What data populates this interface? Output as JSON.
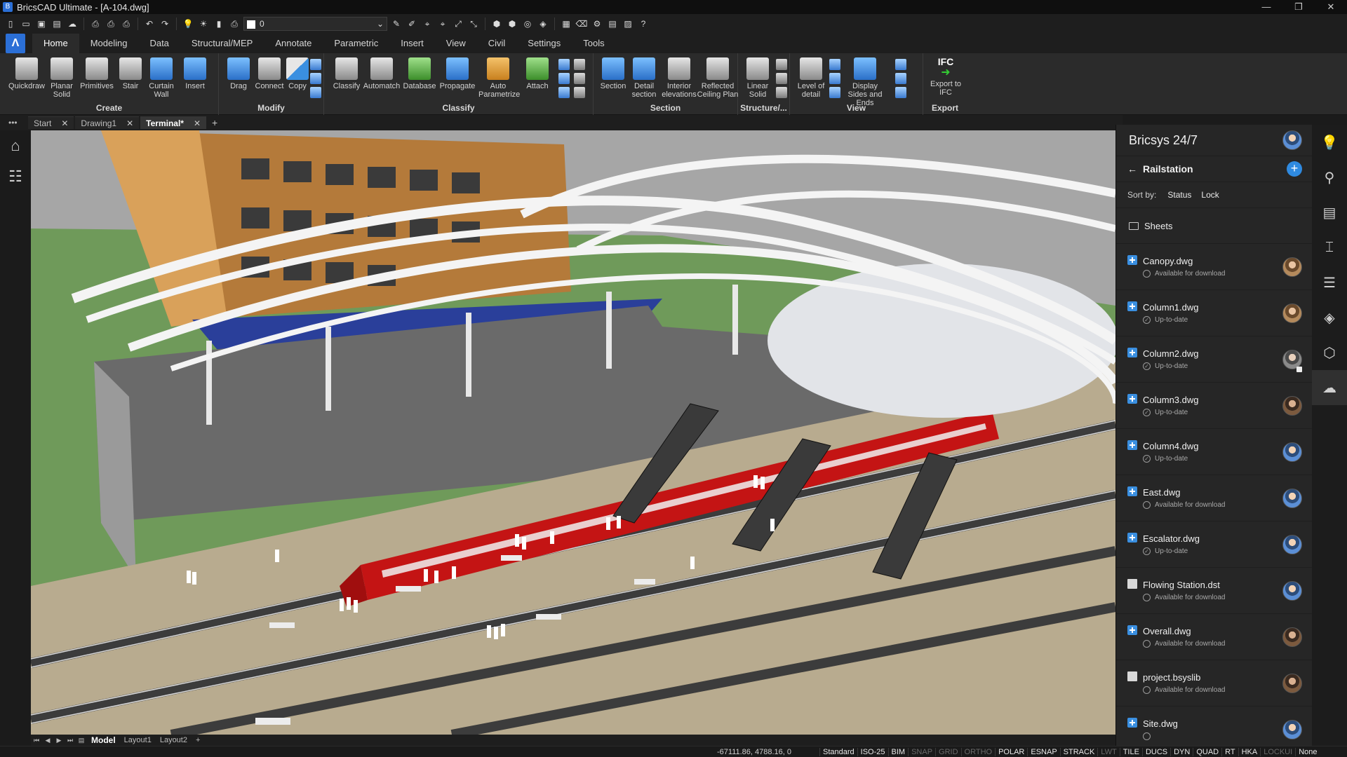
{
  "window": {
    "title": "BricsCAD Ultimate - [A-104.dwg]",
    "controls": [
      "—",
      "❐",
      "✕"
    ]
  },
  "quick_access": {
    "layer_value": "0"
  },
  "ribbon_tabs": [
    "Home",
    "Modeling",
    "Data",
    "Structural/MEP",
    "Annotate",
    "Parametric",
    "Insert",
    "View",
    "Civil",
    "Settings",
    "Tools"
  ],
  "ribbon": {
    "groups": {
      "create": "Create",
      "modify": "Modify",
      "classify": "Classify",
      "section": "Section",
      "structure": "Structure/...",
      "view": "View",
      "export": "Export"
    },
    "buttons": {
      "quickdraw": "Quickdraw",
      "planar_solid": "Planar Solid",
      "primitives": "Primitives",
      "stair": "Stair",
      "curtain_wall": "Curtain Wall",
      "insert": "Insert",
      "drag": "Drag",
      "connect": "Connect",
      "copy": "Copy",
      "classify": "Classify",
      "automatch": "Automatch",
      "database": "Database",
      "propagate": "Propagate",
      "auto_parametrize": "Auto Parametrize",
      "attach": "Attach",
      "section": "Section",
      "detail_section": "Detail section",
      "interior_elevations": "Interior elevations",
      "reflected_ceiling_plan": "Reflected Ceiling Plan",
      "linear_solid": "Linear Solid",
      "level_of_detail": "Level of detail",
      "display_sides": "Display Sides and Ends",
      "ifc_label": "IFC",
      "export_ifc": "Export to IFC"
    }
  },
  "doc_tabs": [
    {
      "label": "Start"
    },
    {
      "label": "Drawing1"
    },
    {
      "label": "Terminal*"
    }
  ],
  "layout_tabs": [
    "Model",
    "Layout1",
    "Layout2",
    "+"
  ],
  "status_bar": {
    "coords": "-67111.86, 4788.16, 0",
    "toggles": [
      {
        "label": "Standard",
        "on": true
      },
      {
        "label": "ISO-25",
        "on": true
      },
      {
        "label": "BIM",
        "on": true
      },
      {
        "label": "SNAP",
        "on": false
      },
      {
        "label": "GRID",
        "on": false
      },
      {
        "label": "ORTHO",
        "on": false
      },
      {
        "label": "POLAR",
        "on": true
      },
      {
        "label": "ESNAP",
        "on": true
      },
      {
        "label": "STRACK",
        "on": true
      },
      {
        "label": "LWT",
        "on": false
      },
      {
        "label": "TILE",
        "on": true
      },
      {
        "label": "DUCS",
        "on": true
      },
      {
        "label": "DYN",
        "on": true
      },
      {
        "label": "QUAD",
        "on": true
      },
      {
        "label": "RT",
        "on": true
      },
      {
        "label": "HKA",
        "on": true
      },
      {
        "label": "LOCKUI",
        "on": false
      },
      {
        "label": "None",
        "on": true
      }
    ]
  },
  "panel": {
    "title": "Bricsys 24/7",
    "folder": "Railstation",
    "sort_label": "Sort by:",
    "sort_options": [
      "Status",
      "Lock"
    ],
    "sheets_label": "Sheets",
    "files": [
      {
        "name": "Canopy.dwg",
        "status": "Available for download",
        "kind": "dwg",
        "avatar": "brown"
      },
      {
        "name": "Column1.dwg",
        "status": "Up-to-date",
        "kind": "dwg",
        "avatar": "brown"
      },
      {
        "name": "Column2.dwg",
        "status": "Up-to-date",
        "kind": "dwg",
        "avatar": "gray"
      },
      {
        "name": "Column3.dwg",
        "status": "Up-to-date",
        "kind": "dwg",
        "avatar": "dark"
      },
      {
        "name": "Column4.dwg",
        "status": "Up-to-date",
        "kind": "dwg",
        "avatar": "blue"
      },
      {
        "name": "East.dwg",
        "status": "Available for download",
        "kind": "dwg",
        "avatar": "blue"
      },
      {
        "name": "Escalator.dwg",
        "status": "Up-to-date",
        "kind": "dwg",
        "avatar": "blue"
      },
      {
        "name": "Flowing Station.dst",
        "status": "Available for download",
        "kind": "doc",
        "avatar": "blue"
      },
      {
        "name": "Overall.dwg",
        "status": "Available for download",
        "kind": "dwg",
        "avatar": "dark"
      },
      {
        "name": "project.bsyslib",
        "status": "Available for download",
        "kind": "doc",
        "avatar": "dark"
      },
      {
        "name": "Site.dwg",
        "status": "",
        "kind": "dwg",
        "avatar": "blue"
      }
    ]
  },
  "colors": {
    "accent": "#2f8ae0",
    "train": "#c41414",
    "ground": "#b8ab8f"
  }
}
